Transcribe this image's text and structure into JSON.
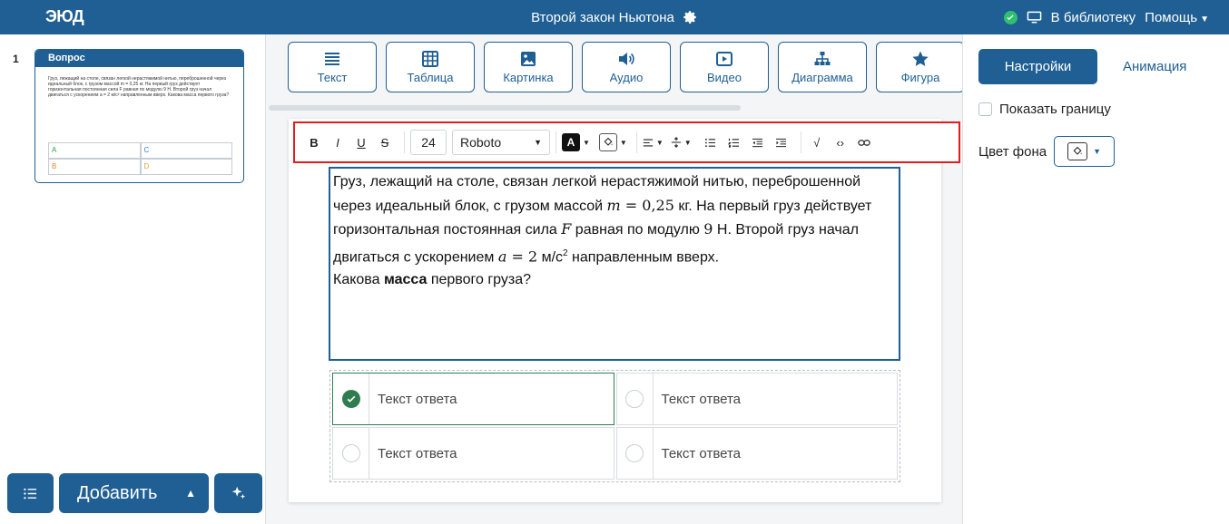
{
  "topbar": {
    "logo": "ЭЮД",
    "title": "Второй закон Ньютона",
    "library": "В библиотеку",
    "help": "Помощь",
    "colors": {
      "bar": "#1f5f93",
      "status": "#2fbf71"
    }
  },
  "left": {
    "slide_number": "1",
    "thumb_title": "Вопрос",
    "thumb_text": "Груз, лежащий на столе, связан легкой нерастяжимой нитью, переброшенной через идеальный блок, с грузом массой m = 0,25 кг. На первый груз действует горизонтальная постоянная сила F равная по модулю 9 Н. Второй груз начал двигаться с ускорением a = 2 м/с² направленным вверх. Какова масса первого груза?",
    "thumb_answers": [
      "A",
      "C",
      "B",
      "D"
    ],
    "add_label": "Добавить"
  },
  "toolbar": {
    "items": [
      {
        "label": "Текст",
        "icon": "text-icon"
      },
      {
        "label": "Таблица",
        "icon": "table-icon"
      },
      {
        "label": "Картинка",
        "icon": "image-icon"
      },
      {
        "label": "Аудио",
        "icon": "audio-icon"
      },
      {
        "label": "Видео",
        "icon": "video-icon"
      },
      {
        "label": "Диаграмма",
        "icon": "diagram-icon"
      },
      {
        "label": "Фигура",
        "icon": "star-icon"
      }
    ]
  },
  "format": {
    "bold": "B",
    "italic": "I",
    "underline": "U",
    "strike": "S",
    "font_size": "24",
    "font_name": "Roboto",
    "text_color_letter": "A",
    "sqrt": "√",
    "code": "‹›"
  },
  "question": {
    "line1": "Груз, лежащий на столе, связан легкой нерастяжимой нитью, переброшенной",
    "line2_a": "через идеальный блок, с грузом массой ",
    "line2_m": "m",
    "line2_eq": " = 0,25",
    "line2_b": " кг. На первый груз действует",
    "line3_a": "горизонтальная постоянная сила ",
    "line3_f": "F",
    "line3_b": " равная по модулю ",
    "line3_9": "9",
    "line3_c": " Н. Второй груз начал",
    "line4_a": "двигаться с ускорением ",
    "line4_var": "a",
    "line4_eq": " = 2",
    "line4_b": " м/с",
    "line4_sup": "2",
    "line4_c": " направленным вверх.",
    "line5_a": "Какова ",
    "line5_bold": "масса",
    "line5_b": " первого груза?"
  },
  "answers": [
    {
      "text": "Текст ответа",
      "selected": true
    },
    {
      "text": "Текст ответа",
      "selected": false
    },
    {
      "text": "Текст ответа",
      "selected": false
    },
    {
      "text": "Текст ответа",
      "selected": false
    }
  ],
  "right": {
    "tab_settings": "Настройки",
    "tab_animation": "Анимация",
    "show_border": "Показать границу",
    "bg_color": "Цвет фона"
  }
}
